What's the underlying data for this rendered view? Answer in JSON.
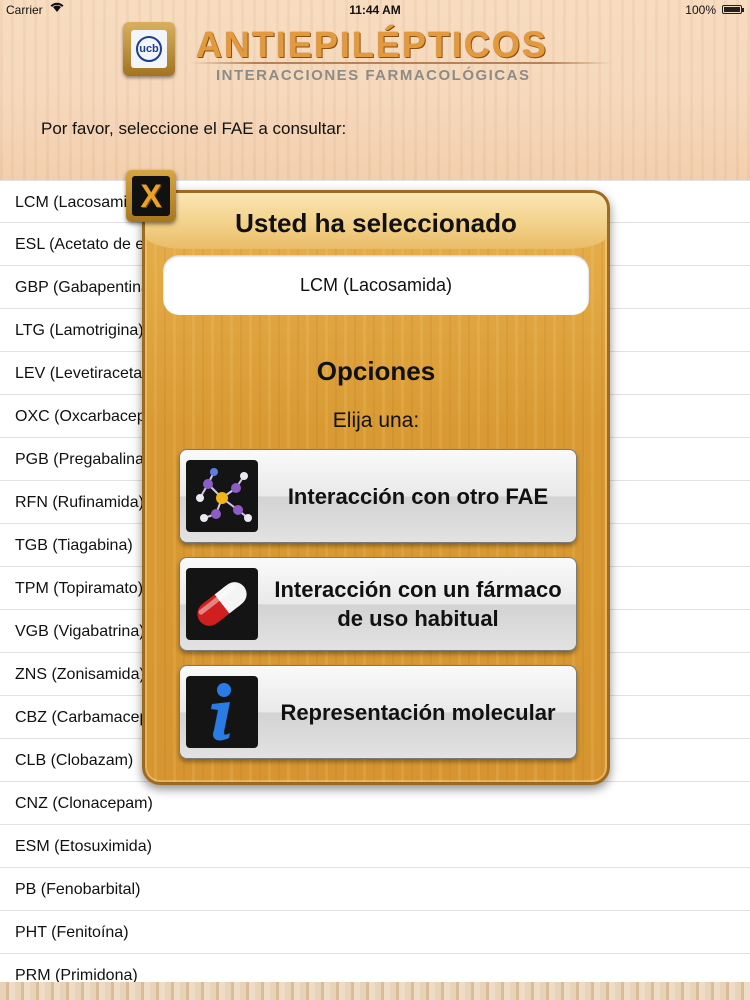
{
  "status_bar": {
    "carrier": "Carrier",
    "time": "11:44 AM",
    "battery": "100%"
  },
  "header": {
    "title": "ANTIEPILÉPTICOS",
    "subtitle": "INTERACCIONES FARMACOLÓGICAS",
    "logo_text": "ucb",
    "prompt": "Por favor, seleccione el FAE a consultar:"
  },
  "drug_list": [
    "LCM (Lacosamida)",
    "ESL (Acetato de eslicarbazepina)",
    "GBP (Gabapentina)",
    "LTG (Lamotrigina)",
    "LEV (Levetiracetam)",
    "OXC (Oxcarbacepina)",
    "PGB (Pregabalina)",
    "RFN (Rufinamida)",
    "TGB (Tiagabina)",
    "TPM (Topiramato)",
    "VGB (Vigabatrina)",
    "ZNS (Zonisamida)",
    "CBZ (Carbamacepina)",
    "CLB (Clobazam)",
    "CNZ (Clonacepam)",
    "ESM (Etosuximida)",
    "PB (Fenobarbital)",
    "PHT (Fenitoína)",
    "PRM (Primidona)"
  ],
  "modal": {
    "close_label": "X",
    "title": "Usted ha seleccionado",
    "selected": "LCM (Lacosamida)",
    "options_title": "Opciones",
    "options_subtitle": "Elija una:",
    "options": [
      {
        "label": "Interacción con otro FAE",
        "icon": "molecule-icon"
      },
      {
        "label": "Interacción con un fármaco de uso habitual",
        "icon": "pill-icon"
      },
      {
        "label": "Representación molecular",
        "icon": "info-icon"
      }
    ]
  },
  "colors": {
    "title_orange": "#e49a3a",
    "modal_wood": "#d99a33",
    "header_wood": "#f6d9bd"
  }
}
